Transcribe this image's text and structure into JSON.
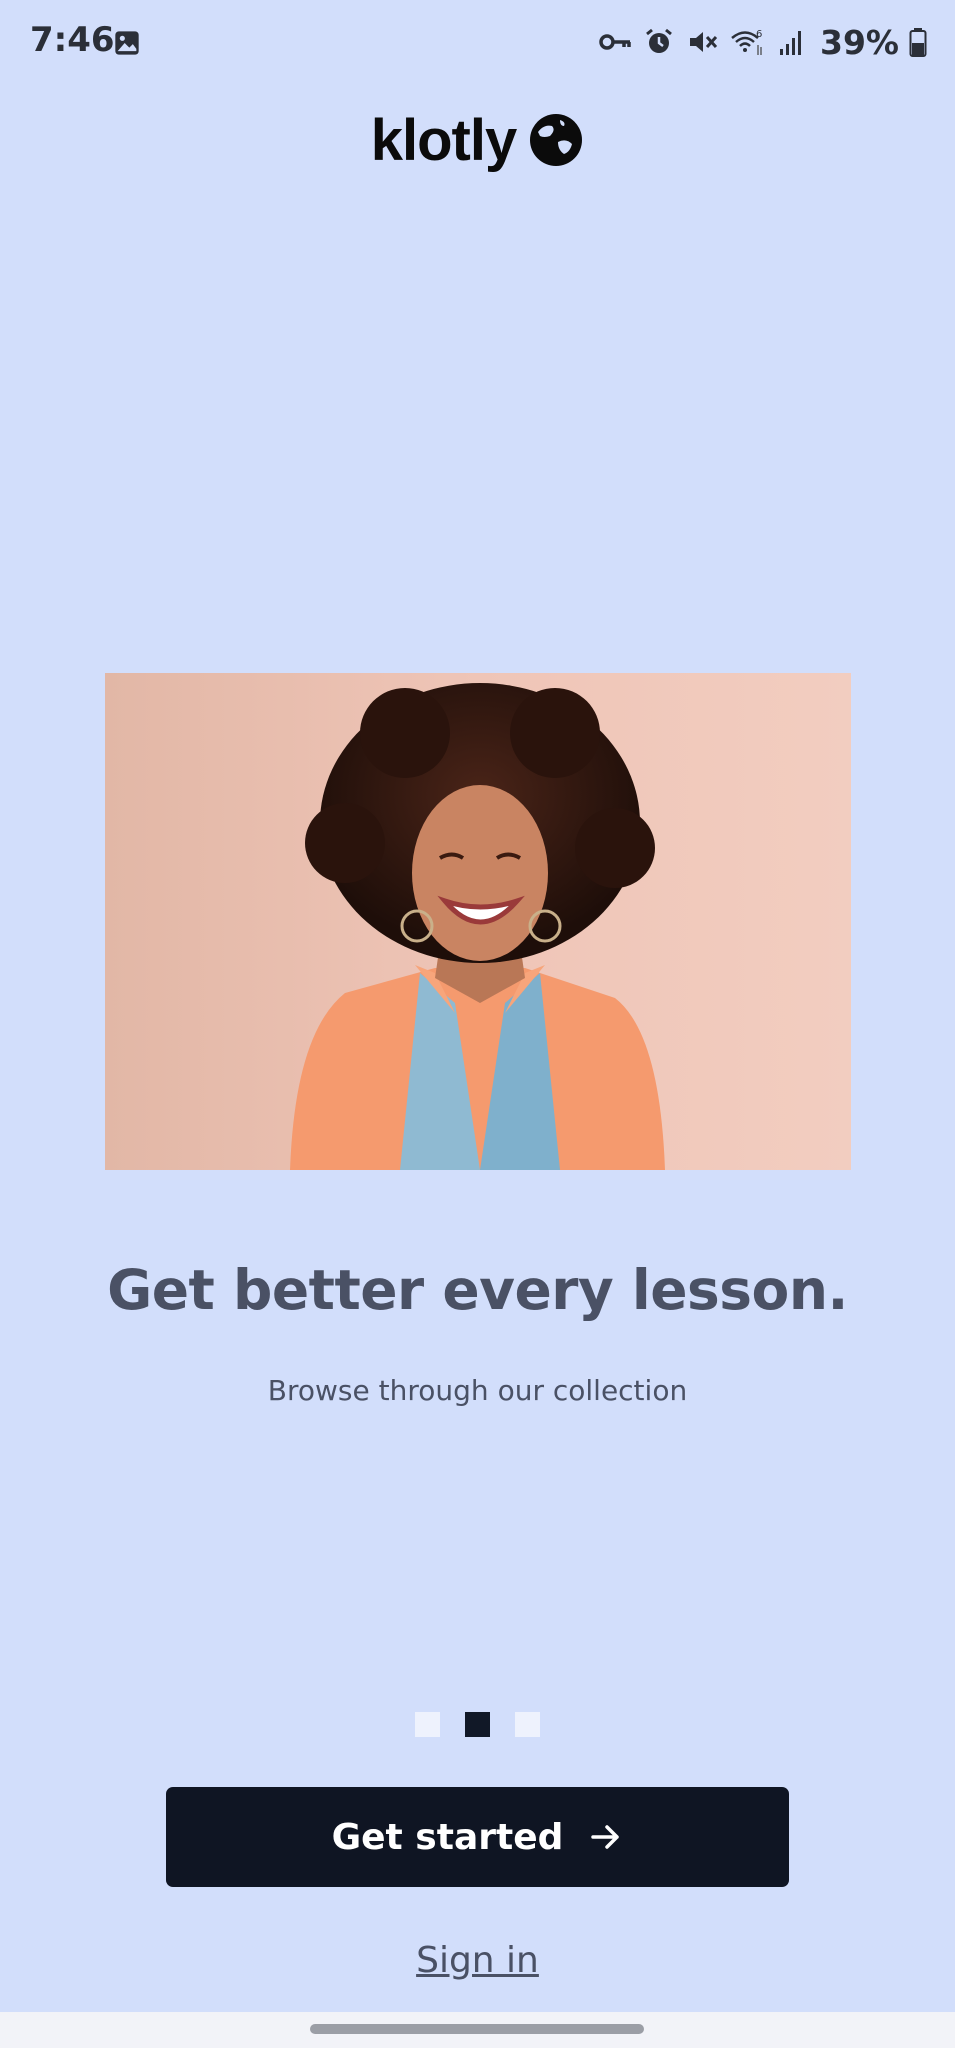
{
  "status_bar": {
    "time": "7:46",
    "battery_percent": "39%",
    "icons": [
      "gallery-icon",
      "vpn-key-icon",
      "alarm-icon",
      "mute-icon",
      "wifi-6-icon",
      "signal-icon",
      "battery-icon"
    ]
  },
  "logo": {
    "text": "klotly",
    "icon": "globe-icon"
  },
  "hero": {
    "image": "smiling-woman-photo",
    "background_color": "#efc5b7"
  },
  "onboarding": {
    "headline": "Get better every lesson.",
    "subheadline": "Browse through our collection",
    "page_count": 3,
    "active_page": 2
  },
  "actions": {
    "primary_label": "Get started",
    "primary_icon": "arrow-right-icon",
    "secondary_label": "Sign in"
  },
  "colors": {
    "background": "#d2defb",
    "primary_button": "#0f1523",
    "text_muted": "#4a5165"
  }
}
